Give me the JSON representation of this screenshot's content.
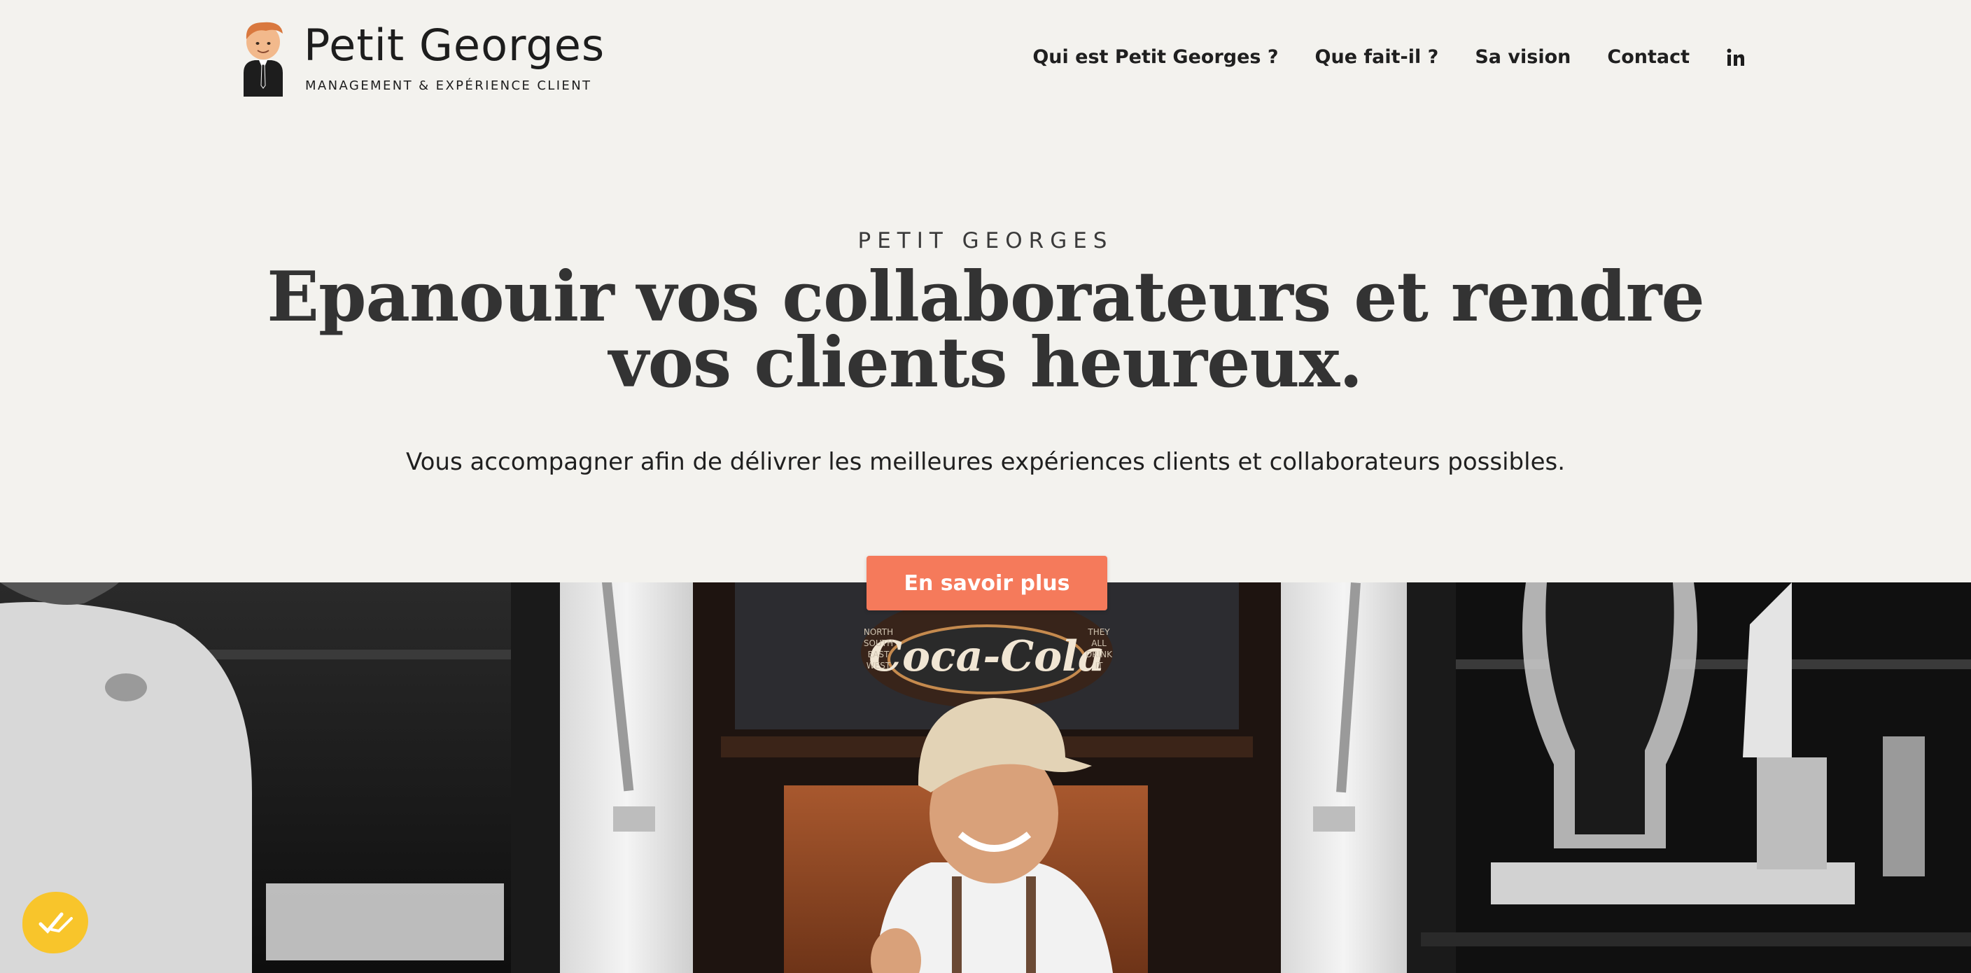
{
  "brand": {
    "name_first": "Petit",
    "name_last": "Georges",
    "tagline": "MANAGEMENT & EXPÉRIENCE CLIENT"
  },
  "nav": {
    "items": [
      {
        "label": "Qui est Petit Georges ?"
      },
      {
        "label": "Que fait-il ?"
      },
      {
        "label": "Sa vision"
      },
      {
        "label": "Contact"
      }
    ],
    "social_icon": "linkedin-icon"
  },
  "hero": {
    "eyebrow": "PETIT GEORGES",
    "headline": "Epanouir vos collaborateurs et rendre vos clients heureux.",
    "subtitle": "Vous accompagner afin de délivrer les meilleures expériences clients et collaborateurs possibles.",
    "cta_label": "En savoir plus"
  },
  "photo": {
    "sign_text": "Coca-Cola",
    "sign_left": [
      "NORTH",
      "SOUTH",
      "EAST",
      "WEST"
    ],
    "sign_right": [
      "THEY",
      "ALL",
      "DRINK",
      "IT"
    ]
  },
  "colors": {
    "background": "#f3f2ee",
    "accent": "#f57a5b",
    "badge": "#f8c52b",
    "text": "#333333"
  }
}
